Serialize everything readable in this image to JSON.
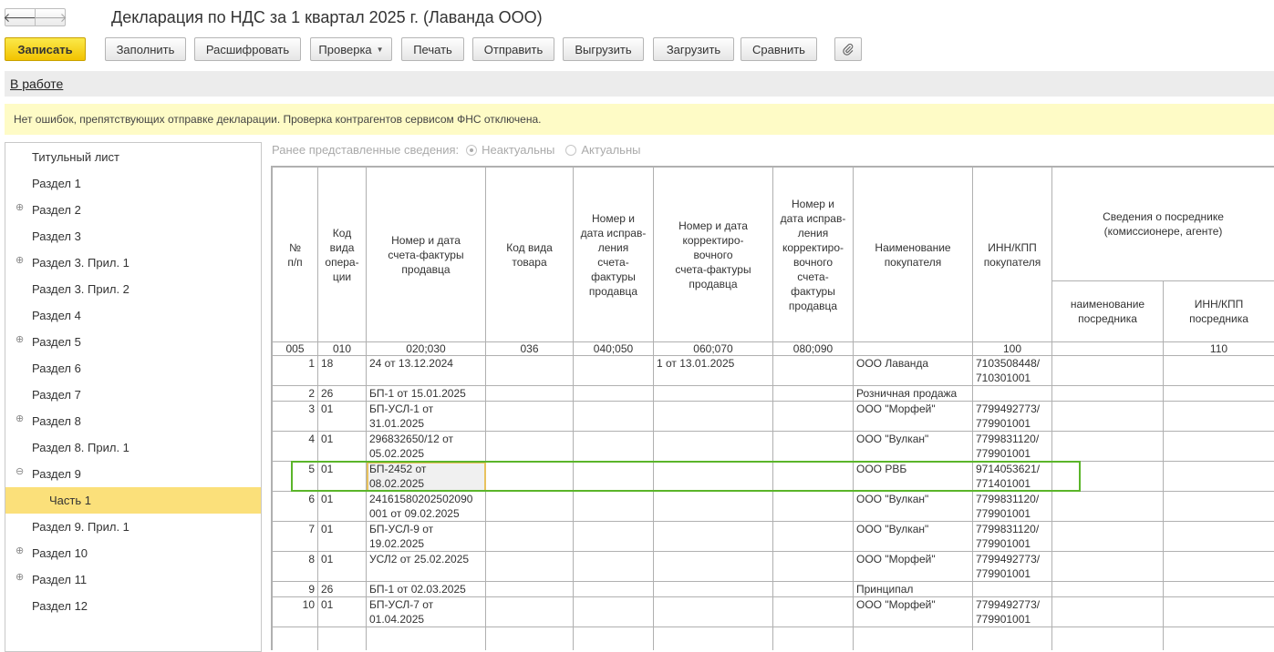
{
  "window": {
    "title": "Декларация по НДС за 1 квартал 2025 г. (Лаванда ООО)"
  },
  "nav": {
    "back_icon": "arrow-left-icon",
    "forward_icon": "arrow-right-icon",
    "back_glyph": "🡐",
    "forward_glyph": "🡒"
  },
  "toolbar": {
    "save": "Записать",
    "fill": "Заполнить",
    "decode": "Расшифровать",
    "check": "Проверка",
    "print": "Печать",
    "send": "Отправить",
    "export": "Выгрузить",
    "import": "Загрузить",
    "compare": "Сравнить",
    "attach_icon": "paperclip-icon"
  },
  "status": {
    "link": "В работе"
  },
  "info": {
    "message": "Нет ошибок, препятствующих отправке декларации. Проверка контрагентов сервисом ФНС отключена."
  },
  "sidebar": {
    "items": [
      {
        "label": "Титульный лист",
        "expander": ""
      },
      {
        "label": "Раздел 1",
        "expander": ""
      },
      {
        "label": "Раздел 2",
        "expander": "⊕"
      },
      {
        "label": "Раздел 3",
        "expander": ""
      },
      {
        "label": "Раздел 3. Прил. 1",
        "expander": "⊕"
      },
      {
        "label": "Раздел 3. Прил. 2",
        "expander": ""
      },
      {
        "label": "Раздел 4",
        "expander": ""
      },
      {
        "label": "Раздел 5",
        "expander": "⊕"
      },
      {
        "label": "Раздел 6",
        "expander": ""
      },
      {
        "label": "Раздел 7",
        "expander": ""
      },
      {
        "label": "Раздел 8",
        "expander": "⊕"
      },
      {
        "label": "Раздел 8. Прил. 1",
        "expander": ""
      },
      {
        "label": "Раздел 9",
        "expander": "⊖"
      },
      {
        "label": "Часть 1",
        "expander": ""
      },
      {
        "label": "Раздел 9. Прил. 1",
        "expander": ""
      },
      {
        "label": "Раздел 10",
        "expander": "⊕"
      },
      {
        "label": "Раздел 11",
        "expander": "⊕"
      },
      {
        "label": "Раздел 12",
        "expander": ""
      }
    ],
    "selected_index": 13
  },
  "previous_info": {
    "label": "Ранее представленные сведения:",
    "option_not_actual": "Неактуальны",
    "option_actual": "Актуальны",
    "selected": "not_actual"
  },
  "table": {
    "headers": {
      "num": "№\nп/п",
      "op_code": "Код\nвида\nопера-\nции",
      "invoice": "Номер и дата\nсчета-фактуры\nпродавца",
      "goods_code": "Код вида\nтовара",
      "invoice_fix": "Номер и\nдата исправ-\nления\nсчета-\nфактуры\nпродавца",
      "corr_invoice": "Номер и дата\nкорректиро-\nвочного\nсчета-фактуры\nпродавца",
      "corr_fix": "Номер и\nдата исправ-\nления\nкорректиро-\nвочного\nсчета-\nфактуры\nпродавца",
      "buyer": "Наименование\nпокупателя",
      "buyer_inn": "ИНН/КПП\nпокупателя",
      "agent_group": "Сведения о посреднике\n(комиссионере, агенте)",
      "agent_name": "наименование\nпосредника",
      "agent_inn": "ИНН/КПП\nпосредника"
    },
    "codes": [
      "005",
      "010",
      "020;030",
      "036",
      "040;050",
      "060;070",
      "080;090",
      "",
      "100",
      "",
      "110"
    ],
    "rows": [
      {
        "n": "1",
        "op": "18",
        "invoice": "24 от 13.12.2024",
        "goods": "",
        "fix": "",
        "corr": "1 от 13.01.2025",
        "corr_fix": "",
        "buyer": "ООО Лаванда",
        "inn": "7103508448/\n710301001",
        "agent": "",
        "agent_inn": ""
      },
      {
        "n": "2",
        "op": "26",
        "invoice": "БП-1 от 15.01.2025",
        "goods": "",
        "fix": "",
        "corr": "",
        "corr_fix": "",
        "buyer": "Розничная продажа",
        "inn": "",
        "agent": "",
        "agent_inn": ""
      },
      {
        "n": "3",
        "op": "01",
        "invoice": "БП-УСЛ-1 от\n31.01.2025",
        "goods": "",
        "fix": "",
        "corr": "",
        "corr_fix": "",
        "buyer": "ООО \"Морфей\"",
        "inn": "7799492773/\n779901001",
        "agent": "",
        "agent_inn": ""
      },
      {
        "n": "4",
        "op": "01",
        "invoice": "296832650/12 от\n05.02.2025",
        "goods": "",
        "fix": "",
        "corr": "",
        "corr_fix": "",
        "buyer": "ООО \"Вулкан\"",
        "inn": "7799831120/\n779901001",
        "agent": "",
        "agent_inn": ""
      },
      {
        "n": "5",
        "op": "01",
        "invoice": "БП-2452 от\n08.02.2025",
        "goods": "",
        "fix": "",
        "corr": "",
        "corr_fix": "",
        "buyer": "ООО РВБ",
        "inn": "9714053621/\n771401001",
        "agent": "",
        "agent_inn": ""
      },
      {
        "n": "6",
        "op": "01",
        "invoice": "24161580202502090\n001 от 09.02.2025",
        "goods": "",
        "fix": "",
        "corr": "",
        "corr_fix": "",
        "buyer": "ООО \"Вулкан\"",
        "inn": "7799831120/\n779901001",
        "agent": "",
        "agent_inn": ""
      },
      {
        "n": "7",
        "op": "01",
        "invoice": "БП-УСЛ-9 от\n19.02.2025",
        "goods": "",
        "fix": "",
        "corr": "",
        "corr_fix": "",
        "buyer": "ООО \"Вулкан\"",
        "inn": "7799831120/\n779901001",
        "agent": "",
        "agent_inn": ""
      },
      {
        "n": "8",
        "op": "01",
        "invoice": "УСЛ2 от 25.02.2025",
        "goods": "",
        "fix": "",
        "corr": "",
        "corr_fix": "",
        "buyer": "ООО \"Морфей\"",
        "inn": "7799492773/\n779901001",
        "agent": "",
        "agent_inn": ""
      },
      {
        "n": "9",
        "op": "26",
        "invoice": "БП-1 от 02.03.2025",
        "goods": "",
        "fix": "",
        "corr": "",
        "corr_fix": "",
        "buyer": "Принципал",
        "inn": "",
        "agent": "",
        "agent_inn": ""
      },
      {
        "n": "10",
        "op": "01",
        "invoice": "БП-УСЛ-7 от\n01.04.2025",
        "goods": "",
        "fix": "",
        "corr": "",
        "corr_fix": "",
        "buyer": "ООО \"Морфей\"",
        "inn": "7799492773/\n779901001",
        "agent": "",
        "agent_inn": ""
      }
    ],
    "current_row_index": 4
  },
  "colors": {
    "primary_button": "#f2c300",
    "selection": "#fbe07a",
    "info_bg": "#fefbc6",
    "highlight": "#5bb52a"
  }
}
